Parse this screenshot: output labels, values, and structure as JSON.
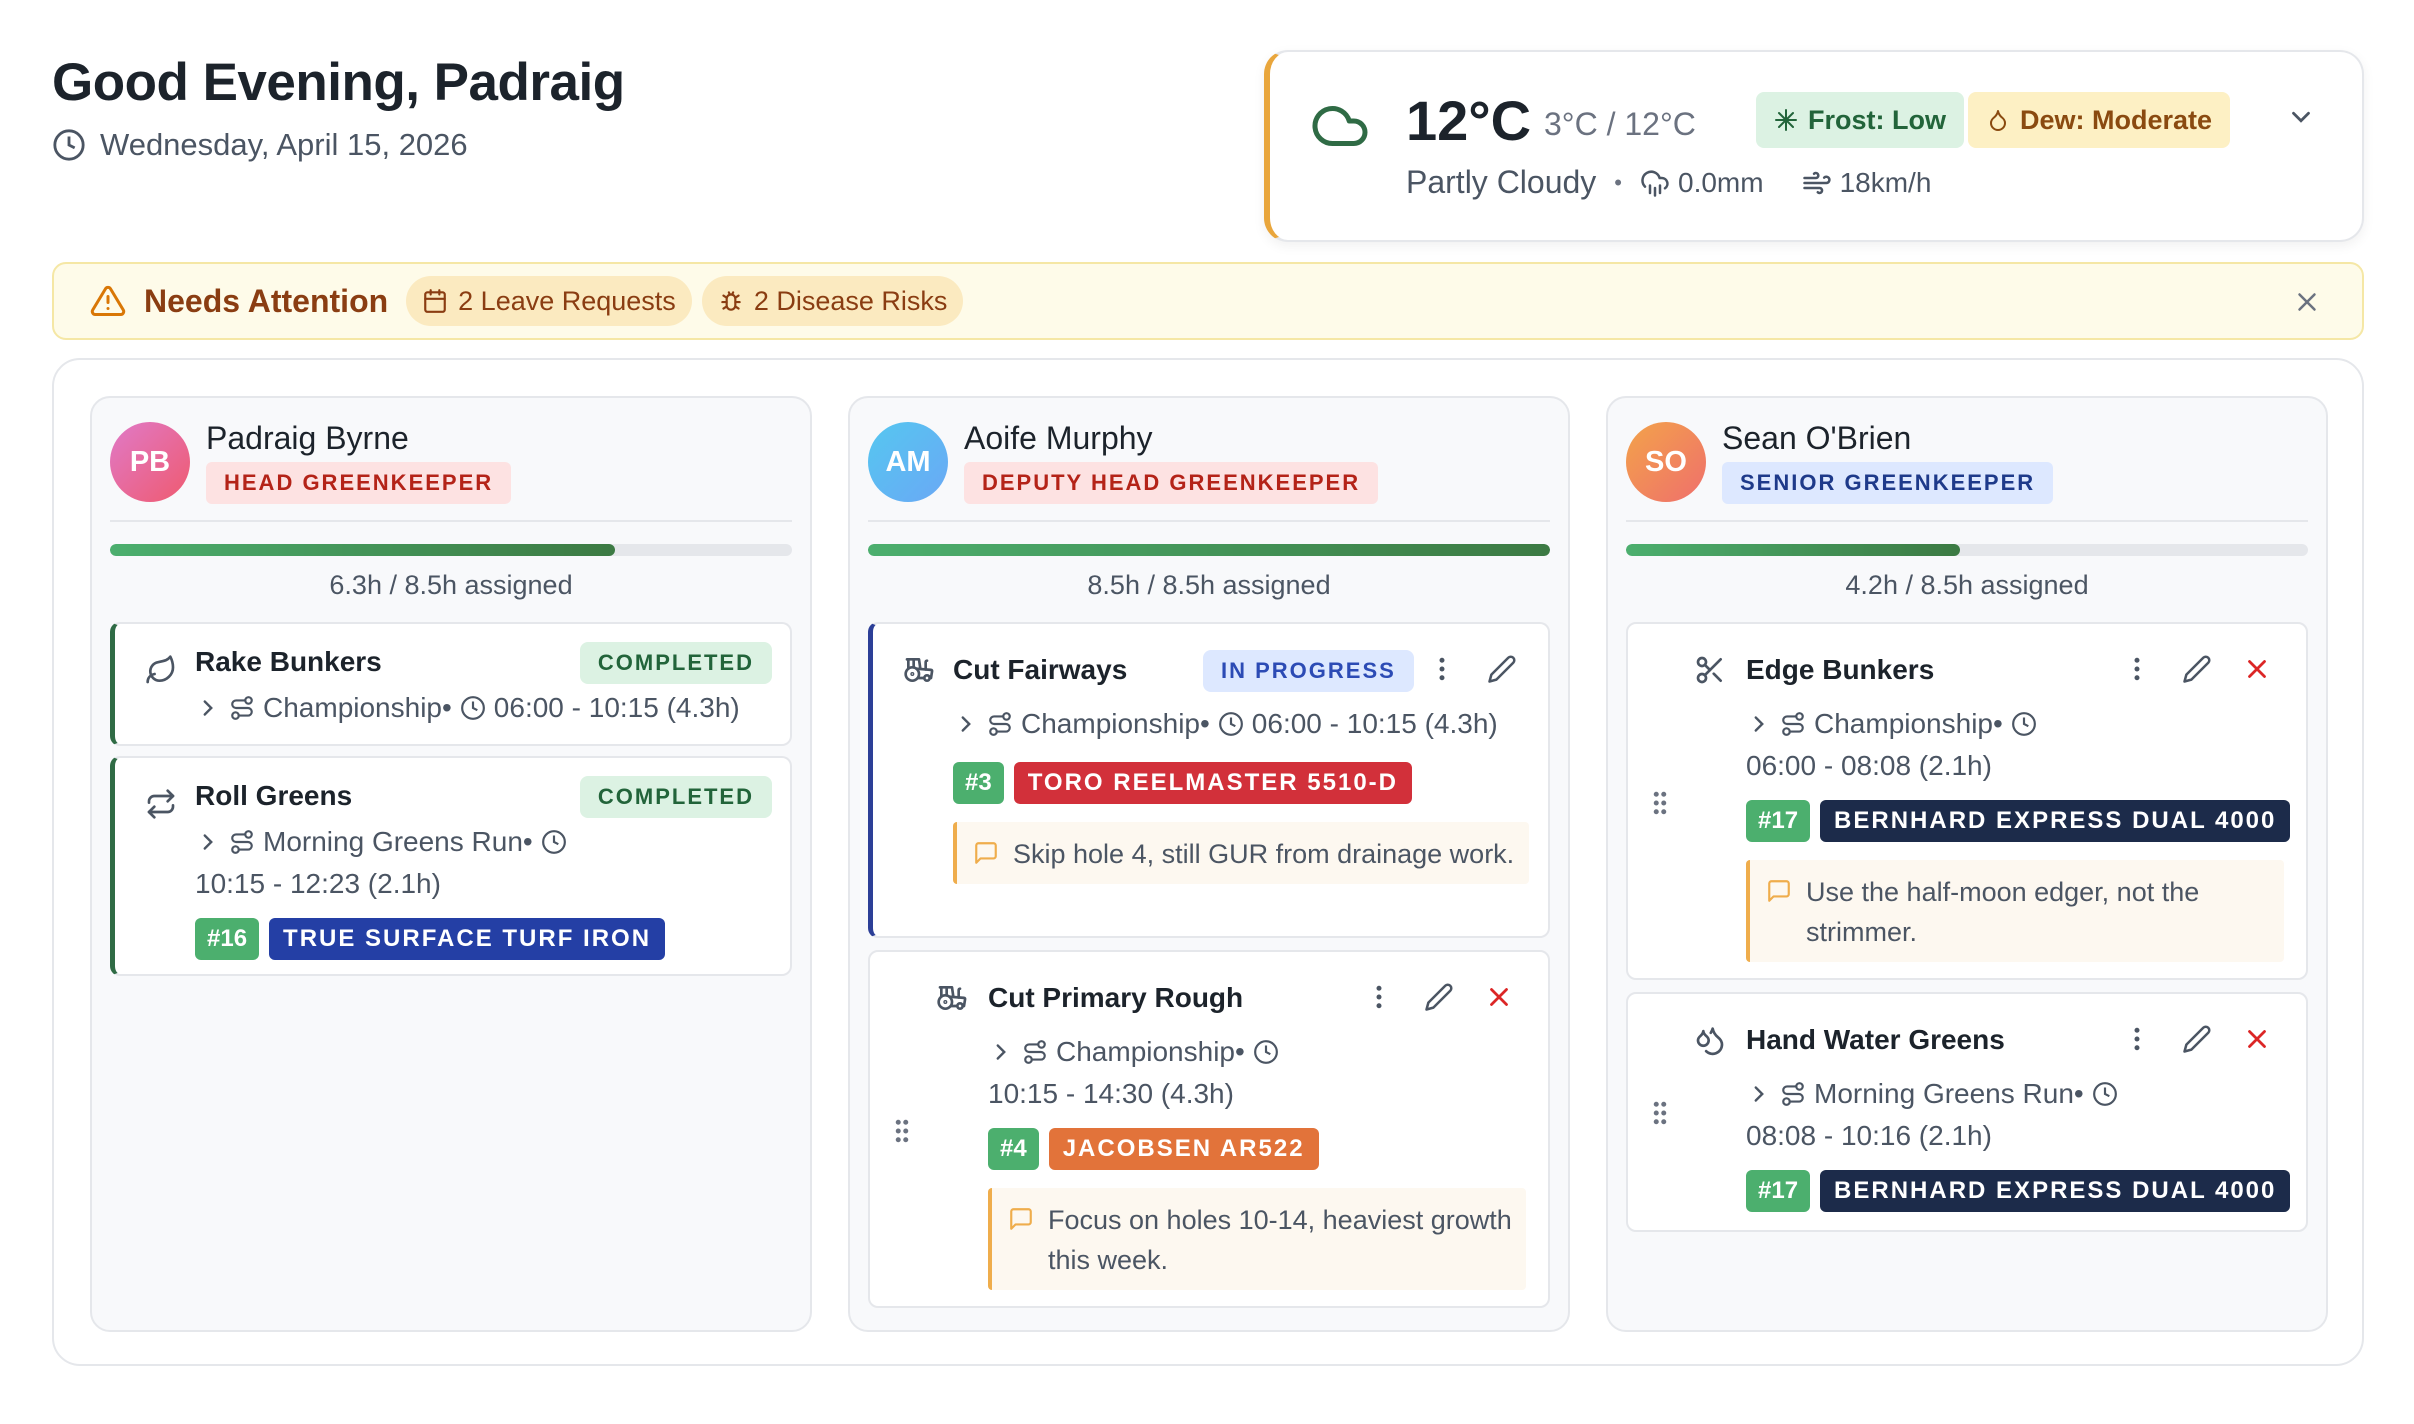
{
  "header": {
    "greeting": "Good Evening, Padraig",
    "date": "Wednesday, April 15, 2026"
  },
  "weather": {
    "temp": "12°C",
    "range": "3°C / 12°C",
    "condition": "Partly Cloudy",
    "separator": "•",
    "rain": "0.0mm",
    "wind": "18km/h",
    "frost": "Frost: Low",
    "dew": "Dew: Moderate",
    "accent": "#e9a63c"
  },
  "attention": {
    "title": "Needs Attention",
    "leave": "2 Leave Requests",
    "disease": "2 Disease Risks"
  },
  "columns": [
    {
      "initials": "PB",
      "name": "Padraig Byrne",
      "role": "HEAD GREENKEEPER",
      "assigned": "6.3h / 8.5h assigned",
      "progress": 0.74,
      "tasks": [
        {
          "title": "Rake Bunkers",
          "status": "COMPLETED",
          "meta": "Championship•",
          "time": "06:00 - 10:15 (4.3h)",
          "icon": "leaf-icon"
        },
        {
          "title": "Roll Greens",
          "status": "COMPLETED",
          "meta": "Morning Greens Run•",
          "time": "10:15 - 12:23 (2.1h)",
          "hole": "#16",
          "equipment": "TRUE SURFACE TURF IRON",
          "icon": "repeat-icon"
        }
      ]
    },
    {
      "initials": "AM",
      "name": "Aoife Murphy",
      "role": "DEPUTY HEAD GREENKEEPER",
      "assigned": "8.5h / 8.5h assigned",
      "progress": 1.0,
      "tasks": [
        {
          "title": "Cut Fairways",
          "status": "IN PROGRESS",
          "meta": "Championship•",
          "time": "06:00 - 10:15 (4.3h)",
          "hole": "#3",
          "equipment": "TORO REELMASTER 5510-D",
          "note": "Skip hole 4, still GUR from drainage work.",
          "icon": "tractor-icon"
        },
        {
          "title": "Cut Primary Rough",
          "meta": "Championship•",
          "time": "10:15 - 14:30 (4.3h)",
          "hole": "#4",
          "equipment": "JACOBSEN AR522",
          "note": "Focus on holes 10-14, heaviest growth this week.",
          "icon": "tractor-icon"
        }
      ]
    },
    {
      "initials": "SO",
      "name": "Sean O'Brien",
      "role": "SENIOR GREENKEEPER",
      "assigned": "4.2h / 8.5h assigned",
      "progress": 0.49,
      "tasks": [
        {
          "title": "Edge Bunkers",
          "meta": "Championship•",
          "time": "06:00 - 08:08 (2.1h)",
          "hole": "#17",
          "equipment": "BERNHARD EXPRESS DUAL 4000",
          "note": "Use the half-moon edger, not the strimmer.",
          "icon": "scissors-icon"
        },
        {
          "title": "Hand Water Greens",
          "meta": "Morning Greens Run•",
          "time": "08:08 - 10:16 (2.1h)",
          "hole": "#17",
          "equipment": "BERNHARD EXPRESS DUAL 4000",
          "icon": "droplets-icon"
        }
      ]
    }
  ]
}
